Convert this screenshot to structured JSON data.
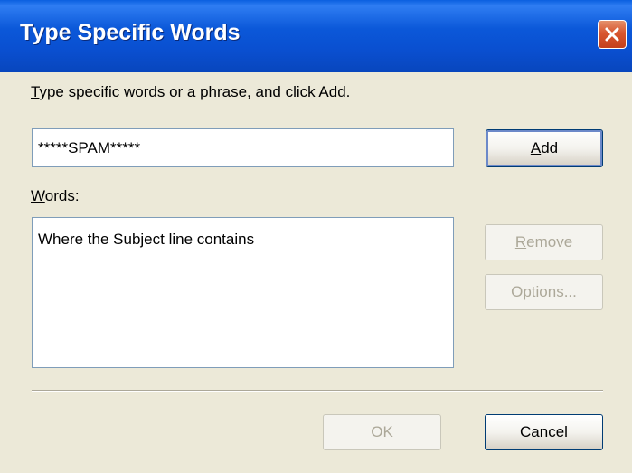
{
  "window": {
    "title": "Type Specific Words",
    "close_icon": "close-icon"
  },
  "colors": {
    "titlebar": "#0a4fd0",
    "close_button": "#d8562f",
    "dialog_bg": "#ece9d8",
    "disabled_text": "#aca899"
  },
  "prompt": {
    "hotkey": "T",
    "rest": "ype specific words or a phrase, and click Add."
  },
  "input": {
    "value": "*****SPAM*****"
  },
  "buttons": {
    "add": {
      "hotkey": "A",
      "rest": "dd",
      "enabled": true
    },
    "remove": {
      "hotkey": "R",
      "rest": "emove",
      "enabled": false
    },
    "options": {
      "hotkey": "O",
      "rest": "ptions...",
      "enabled": false
    },
    "ok": {
      "label": "OK",
      "enabled": false
    },
    "cancel": {
      "label": "Cancel",
      "enabled": true
    }
  },
  "words": {
    "label_hotkey": "W",
    "label_rest": "ords:",
    "items": [
      "Where the Subject line contains"
    ]
  }
}
